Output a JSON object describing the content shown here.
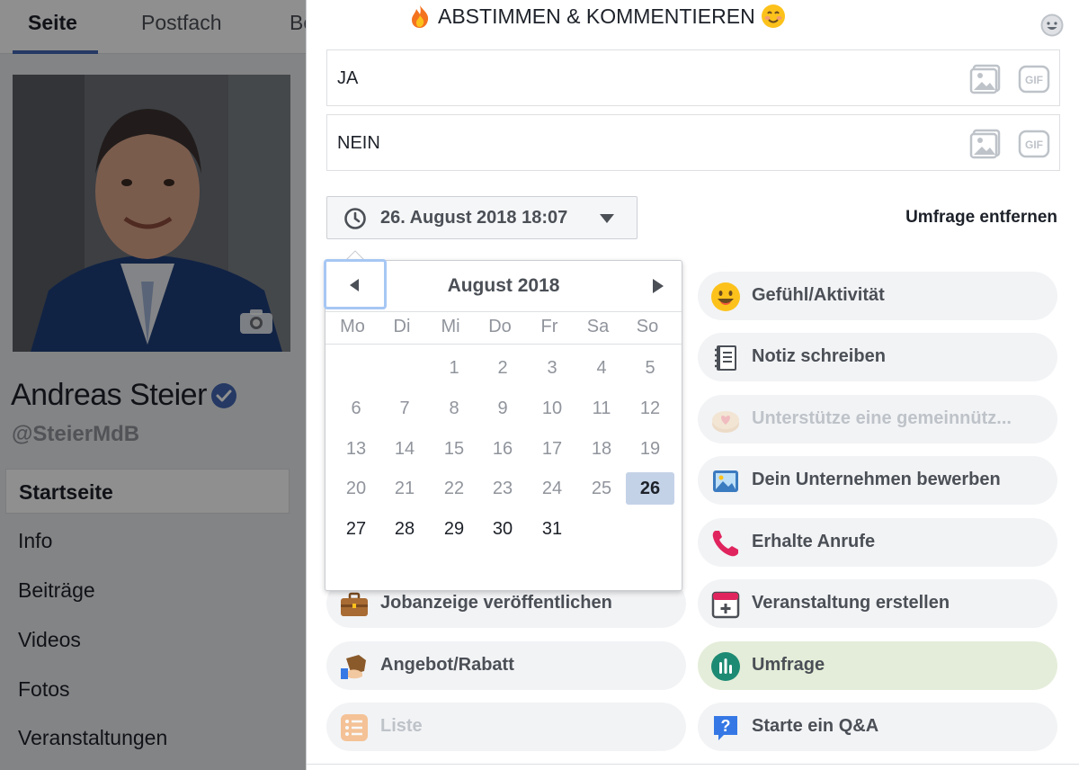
{
  "page": {
    "tabs": [
      "Seite",
      "Postfach",
      "Be"
    ],
    "name": "Andreas Steier",
    "handle": "@SteierMdB",
    "nav": [
      "Startseite",
      "Info",
      "Beiträge",
      "Videos",
      "Fotos",
      "Veranstaltungen"
    ]
  },
  "composer": {
    "title": "ABSTIMMEN & KOMMENTIEREN",
    "options": [
      "JA",
      "NEIN"
    ],
    "date_button": "26. August 2018 18:07",
    "remove_poll": "Umfrage entfernen"
  },
  "calendar": {
    "month": "August 2018",
    "weekdays": [
      "Mo",
      "Di",
      "Mi",
      "Do",
      "Fr",
      "Sa",
      "So"
    ],
    "days": [
      "1",
      "2",
      "3",
      "4",
      "5",
      "6",
      "7",
      "8",
      "9",
      "10",
      "11",
      "12",
      "13",
      "14",
      "15",
      "16",
      "17",
      "18",
      "19",
      "20",
      "21",
      "22",
      "23",
      "24",
      "25",
      "26",
      "27",
      "28",
      "29",
      "30",
      "31"
    ],
    "selected_day": "26"
  },
  "actions": {
    "feeling": "Gefühl/Aktivität",
    "note": "Notiz schreiben",
    "support": "Unterstütze eine gemeinnütz...",
    "promote": "Dein Unternehmen bewerben",
    "calls": "Erhalte Anrufe",
    "job": "Jobanzeige veröffentlichen",
    "event": "Veranstaltung erstellen",
    "offer": "Angebot/Rabatt",
    "poll": "Umfrage",
    "list": "Liste",
    "qa": "Starte ein Q&A"
  },
  "colors": {
    "accent": "#4267b2",
    "selected_day_bg": "#c4d2e7",
    "poll_selected_bg": "#e4edd9"
  }
}
